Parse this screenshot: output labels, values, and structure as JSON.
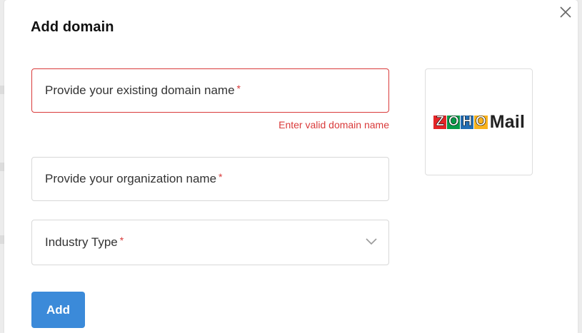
{
  "dialog": {
    "title": "Add domain"
  },
  "fields": {
    "domain": {
      "placeholder": "Provide your existing domain name",
      "required_mark": "*",
      "error": "Enter valid domain name"
    },
    "organization": {
      "placeholder": "Provide your organization name",
      "required_mark": "*"
    },
    "industry": {
      "placeholder": "Industry Type",
      "required_mark": "*"
    }
  },
  "logo": {
    "letters": [
      "Z",
      "O",
      "H",
      "O"
    ],
    "letter_colors": [
      "#e42527",
      "#089949",
      "#226db4",
      "#f9b21d"
    ],
    "suffix": "Mail"
  },
  "actions": {
    "add_label": "Add"
  },
  "colors": {
    "error": "#d93a3a",
    "primary": "#3b8ad9"
  }
}
